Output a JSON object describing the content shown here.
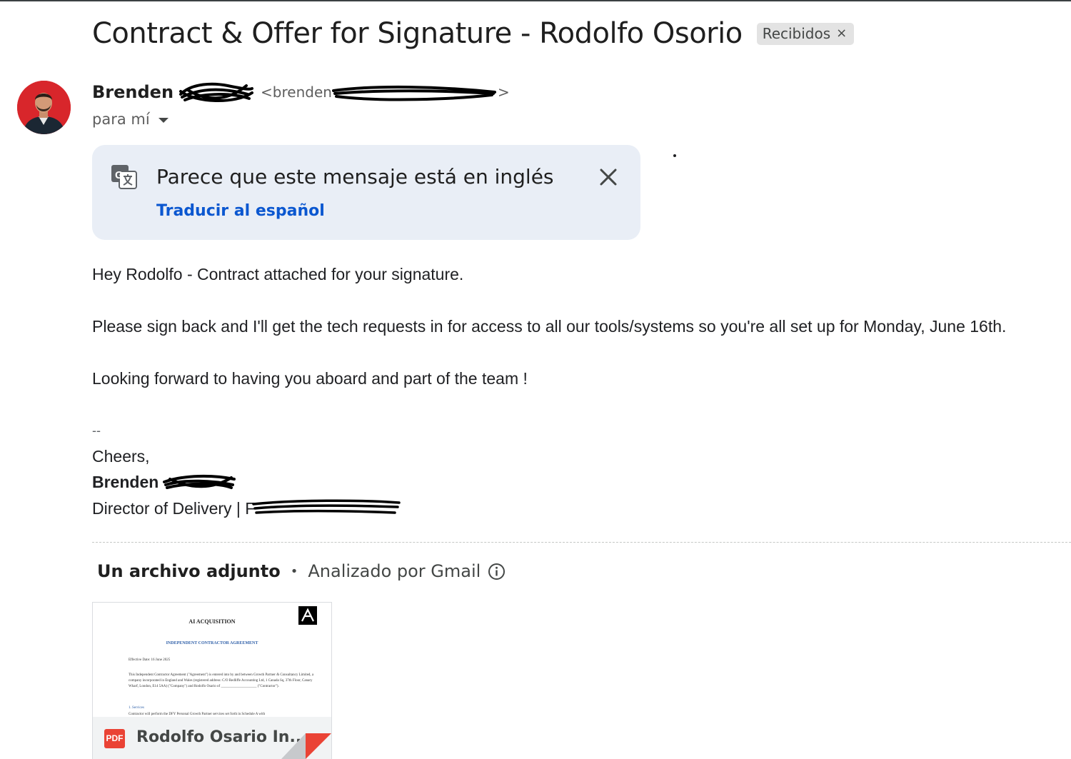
{
  "email": {
    "subject": "Contract & Offer for Signature - Rodolfo Osorio",
    "label": "Recibidos",
    "label_remove": "×",
    "sender": {
      "first_name": "Brenden",
      "email_start": "<brenden",
      "email_end": ">"
    },
    "to": "para mí"
  },
  "translate": {
    "message": "Parece que este mensaje está en inglés",
    "action": "Traducir al español"
  },
  "body": {
    "line1": "Hey Rodolfo -  Contract attached for your signature.",
    "line2": "Please sign back and I'll get the tech requests in for access to all our tools/systems so you're all set up for Monday, June 16th.",
    "line3": "Looking forward to having you aboard and part of the team !"
  },
  "signature": {
    "separator": "--",
    "closing": "Cheers,",
    "name": "Brenden",
    "title": "Director of Delivery | F"
  },
  "attachments": {
    "header": "Un archivo adjunto",
    "separator": "•",
    "scanned": "Analizado por Gmail",
    "file": {
      "name": "Rodolfo Osario In...",
      "type_badge": "PDF",
      "preview": {
        "company": "AI ACQUISITION",
        "heading": "INDEPENDENT CONTRACTOR AGREEMENT",
        "effective_date": "Effective Date: 16 June 2025",
        "paragraph": "This Independent Contractor Agreement (\"Agreement\") is entered into by and between Growth Partner & Consultancy Limited, a company incorporated in England and Wales (registered address: C/O Redliffe Accounting Ltd, 1 Canada Sq, 37th Floor, Canary Wharf, London, E14 5AA) (\"Company\") and Rodolfo Osario of ____________________ (\"Contractor\").",
        "section": "1. Services",
        "section_text": "Contractor will perform the DFY Personal Growth Partner services set forth in Schedule A with"
      }
    }
  },
  "colors": {
    "link": "#0b57d0",
    "translate_bg": "#e9eef6",
    "chip_bg": "#e3e3e3",
    "pdf_red": "#ea4335"
  },
  "icons": [
    "translate-icon",
    "close-icon",
    "info-icon",
    "pdf-icon",
    "chevron-down-icon",
    "avatar"
  ]
}
